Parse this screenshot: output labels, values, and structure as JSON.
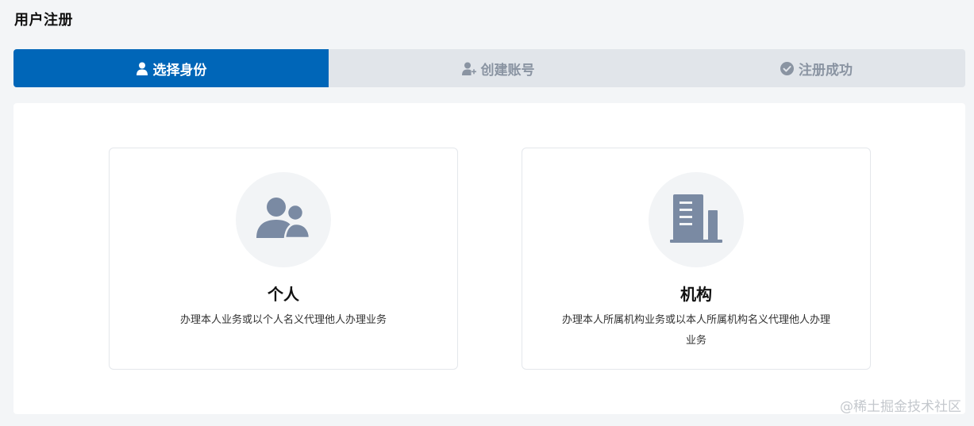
{
  "page": {
    "title": "用户注册"
  },
  "steps": [
    {
      "label": "选择身份",
      "icon": "user-icon",
      "active": true
    },
    {
      "label": "创建账号",
      "icon": "user-add-icon",
      "active": false
    },
    {
      "label": "注册成功",
      "icon": "check-circle-icon",
      "active": false
    }
  ],
  "cards": {
    "personal": {
      "title": "个人",
      "description": "办理本人业务或以个人名义代理他人办理业务",
      "icon": "users-icon"
    },
    "organization": {
      "title": "机构",
      "description": "办理本人所属机构业务或以本人所属机构名义代理他人办理业务",
      "icon": "building-icon"
    }
  },
  "watermark": "@稀土掘金技术社区",
  "colors": {
    "primary": "#0066b8",
    "step_inactive_bg": "#e1e5ea",
    "step_inactive_text": "#8a94a2",
    "icon_fill": "#7a8aa3",
    "page_bg": "#f3f5f7"
  }
}
